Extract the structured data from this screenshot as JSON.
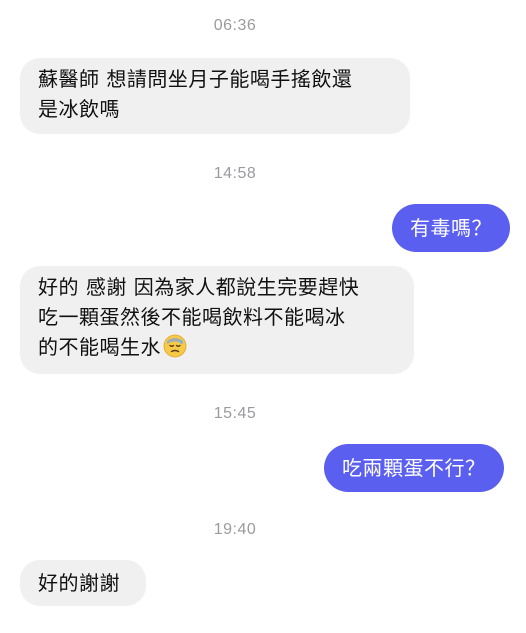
{
  "conversation": {
    "blocks": [
      {
        "time": "06:36",
        "message": {
          "direction": "incoming",
          "lines": [
            "蘇醫師 想請問坐月子能喝手搖飲還",
            "是冰飲嗎"
          ]
        }
      },
      {
        "time": "14:58",
        "message": {
          "direction": "outgoing",
          "text": "有毒嗎？"
        },
        "reply": {
          "direction": "incoming",
          "lines": [
            "好的 感謝 因為家人都說生完要趕快",
            "吃一顆蛋然後不能喝飲料不能喝冰",
            "的不能喝生水"
          ],
          "emoji": "downcast-sweat-face-icon"
        }
      },
      {
        "time": "15:45",
        "message": {
          "direction": "outgoing",
          "text": "吃兩顆蛋不行？"
        }
      },
      {
        "time": "19:40",
        "message": {
          "direction": "incoming",
          "lines": [
            "好的謝謝"
          ]
        }
      }
    ]
  },
  "colors": {
    "incoming_bubble": "#f0f0f0",
    "outgoing_bubble": "#5b5ff0",
    "timestamp": "#9a9a9f"
  }
}
